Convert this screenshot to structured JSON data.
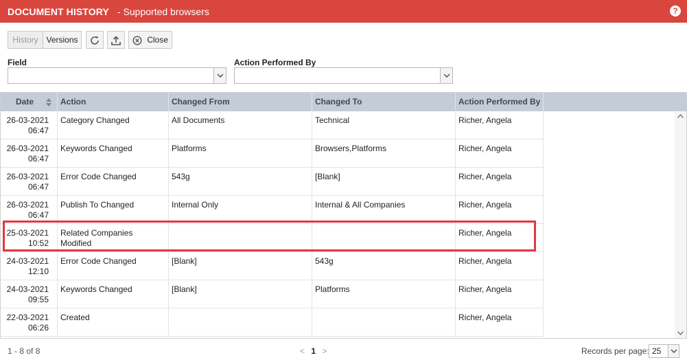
{
  "title": {
    "main": "DOCUMENT HISTORY",
    "sub": "- Supported browsers",
    "help_glyph": "?"
  },
  "toolbar": {
    "history_label": "History",
    "versions_label": "Versions",
    "close_label": "Close"
  },
  "filters": {
    "field_label": "Field",
    "field_value": "",
    "performer_label": "Action Performed By",
    "performer_value": ""
  },
  "table": {
    "columns": [
      "Date",
      "Action",
      "Changed From",
      "Changed To",
      "Action Performed By"
    ],
    "rows": [
      {
        "date": "26-03-2021",
        "time": "06:47",
        "action": "Category Changed",
        "from": "All Documents",
        "to": "Technical",
        "by": "Richer, Angela"
      },
      {
        "date": "26-03-2021",
        "time": "06:47",
        "action": "Keywords Changed",
        "from": "Platforms",
        "to": "Browsers,Platforms",
        "by": "Richer, Angela"
      },
      {
        "date": "26-03-2021",
        "time": "06:47",
        "action": "Error Code Changed",
        "from": "543g",
        "to": "[Blank]",
        "by": "Richer, Angela"
      },
      {
        "date": "26-03-2021",
        "time": "06:47",
        "action": "Publish To Changed",
        "from": "Internal Only",
        "to": "Internal & All Companies",
        "by": "Richer, Angela"
      },
      {
        "date": "25-03-2021",
        "time": "10:52",
        "action": "Related Companies Modified",
        "from": "",
        "to": "",
        "by": "Richer, Angela"
      },
      {
        "date": "24-03-2021",
        "time": "12:10",
        "action": "Error Code Changed",
        "from": "[Blank]",
        "to": "543g",
        "by": "Richer, Angela"
      },
      {
        "date": "24-03-2021",
        "time": "09:55",
        "action": "Keywords Changed",
        "from": "[Blank]",
        "to": "Platforms",
        "by": "Richer, Angela"
      },
      {
        "date": "22-03-2021",
        "time": "06:26",
        "action": "Created",
        "from": "",
        "to": "",
        "by": "Richer, Angela"
      }
    ]
  },
  "footer": {
    "count": "1 - 8 of 8",
    "prev": "<",
    "page": "1",
    "next": ">",
    "records_label": "Records per page:",
    "records_value": "25"
  },
  "colors": {
    "titlebar": "#d9463d",
    "header": "#c4cdd7",
    "highlight": "#e2373f"
  }
}
